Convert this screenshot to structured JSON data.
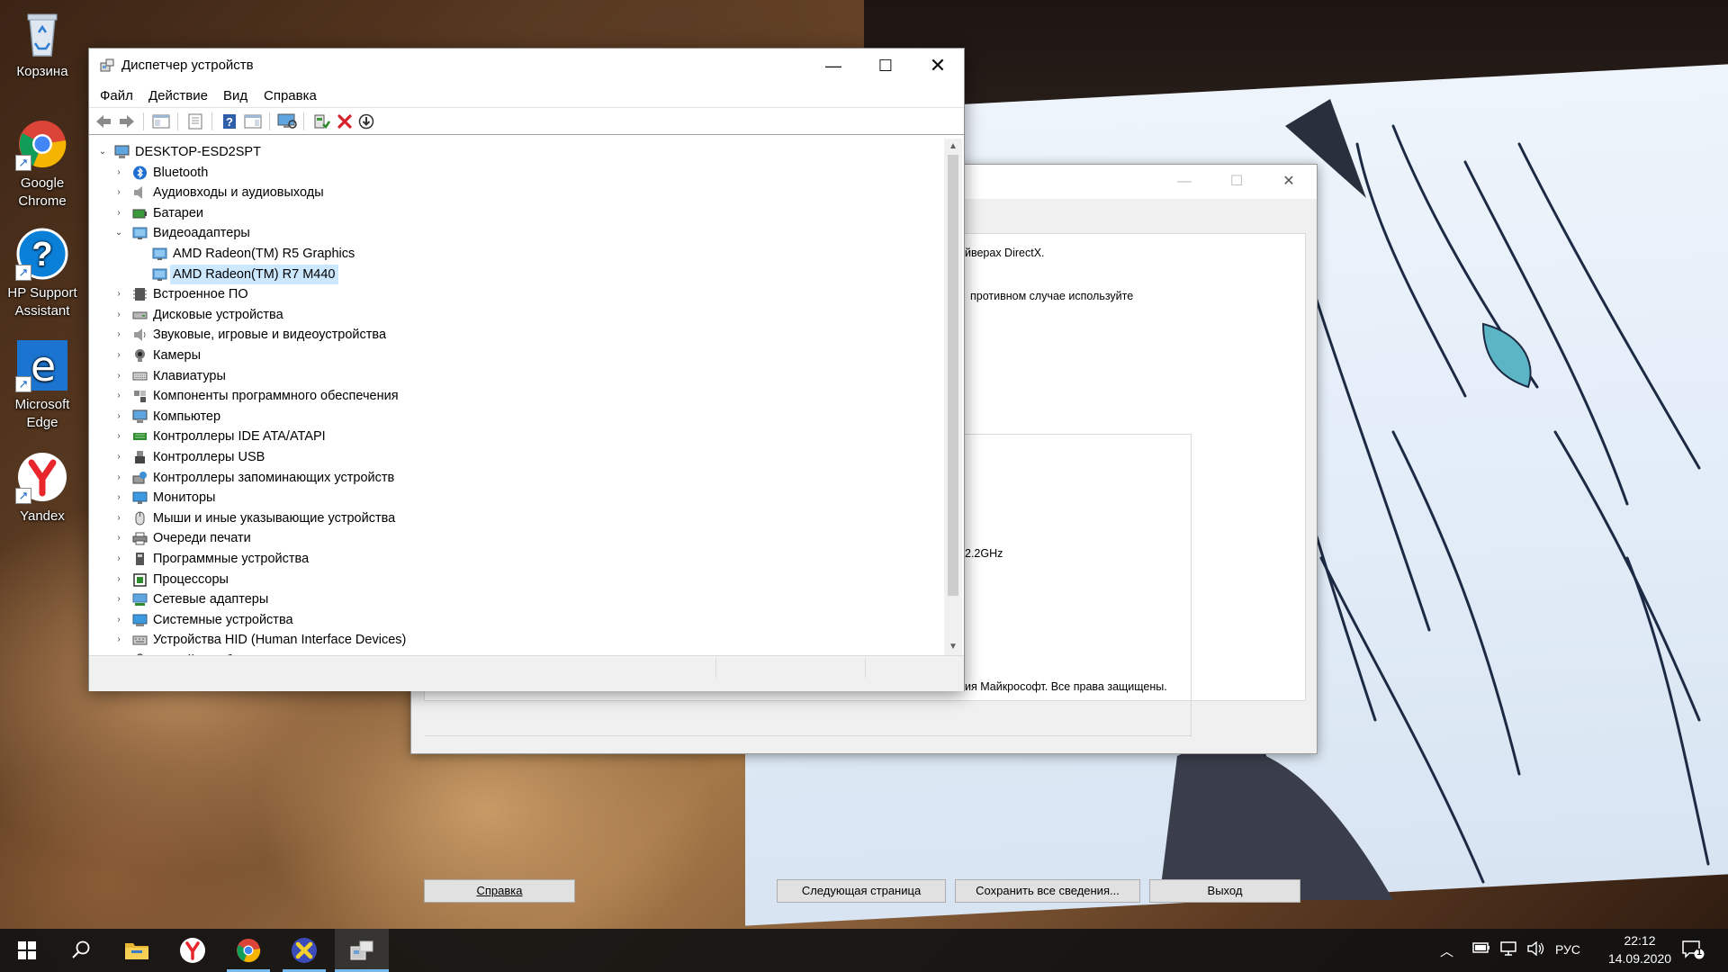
{
  "desktop": {
    "icons": [
      {
        "name": "recycle-bin",
        "label": "Корзина"
      },
      {
        "name": "google-chrome",
        "label": "Google Chrome"
      },
      {
        "name": "hp-support-assistant",
        "label": "HP Support Assistant"
      },
      {
        "name": "microsoft-edge",
        "label": "Microsoft Edge"
      },
      {
        "name": "yandex",
        "label": "Yandex"
      }
    ]
  },
  "dxdiag": {
    "texts": [
      "йверах DirectX.",
      "противном случае используйте",
      "2.2GHz",
      "ия Майкрософт. Все права защищены."
    ],
    "buttons": {
      "help": "Справка",
      "next_page": "Следующая страница",
      "save_all": "Сохранить все сведения...",
      "exit": "Выход"
    }
  },
  "device_manager": {
    "title": "Диспетчер устройств",
    "menu": [
      "Файл",
      "Действие",
      "Вид",
      "Справка"
    ],
    "root": "DESKTOP-ESD2SPT",
    "items": [
      {
        "label": "Bluetooth",
        "icon": "bluetooth-icon",
        "expanded": false
      },
      {
        "label": "Аудиовходы и аудиовыходы",
        "icon": "speaker-icon",
        "expanded": false
      },
      {
        "label": "Батареи",
        "icon": "battery-icon",
        "expanded": false
      },
      {
        "label": "Видеоадаптеры",
        "icon": "display-adapter-icon",
        "expanded": true
      },
      {
        "label": "AMD Radeon(TM) R5 Graphics",
        "icon": "display-adapter-icon",
        "child": true
      },
      {
        "label": "AMD Radeon(TM) R7 M440",
        "icon": "display-adapter-icon",
        "child": true,
        "selected": true
      },
      {
        "label": "Встроенное ПО",
        "icon": "firmware-icon",
        "expanded": false
      },
      {
        "label": "Дисковые устройства",
        "icon": "disk-drive-icon",
        "expanded": false
      },
      {
        "label": "Звуковые, игровые и видеоустройства",
        "icon": "sound-device-icon",
        "expanded": false
      },
      {
        "label": "Камеры",
        "icon": "camera-icon",
        "expanded": false
      },
      {
        "label": "Клавиатуры",
        "icon": "keyboard-icon",
        "expanded": false
      },
      {
        "label": "Компоненты программного обеспечения",
        "icon": "software-component-icon",
        "expanded": false
      },
      {
        "label": "Компьютер",
        "icon": "computer-icon",
        "expanded": false
      },
      {
        "label": "Контроллеры IDE ATA/ATAPI",
        "icon": "ide-controller-icon",
        "expanded": false
      },
      {
        "label": "Контроллеры USB",
        "icon": "usb-icon",
        "expanded": false
      },
      {
        "label": "Контроллеры запоминающих устройств",
        "icon": "storage-controller-icon",
        "expanded": false
      },
      {
        "label": "Мониторы",
        "icon": "monitor-icon",
        "expanded": false
      },
      {
        "label": "Мыши и иные указывающие устройства",
        "icon": "mouse-icon",
        "expanded": false
      },
      {
        "label": "Очереди печати",
        "icon": "printer-icon",
        "expanded": false
      },
      {
        "label": "Программные устройства",
        "icon": "software-device-icon",
        "expanded": false
      },
      {
        "label": "Процессоры",
        "icon": "processor-icon",
        "expanded": false
      },
      {
        "label": "Сетевые адаптеры",
        "icon": "network-adapter-icon",
        "expanded": false
      },
      {
        "label": "Системные устройства",
        "icon": "system-device-icon",
        "expanded": false
      },
      {
        "label": "Устройства HID (Human Interface Devices)",
        "icon": "hid-icon",
        "expanded": false
      },
      {
        "label": "Устройства безопасности",
        "icon": "security-device-icon",
        "expanded": false
      }
    ]
  },
  "taskbar": {
    "apps": [
      {
        "name": "start",
        "icon": "windows-logo-icon"
      },
      {
        "name": "search",
        "icon": "search-icon"
      },
      {
        "name": "file-explorer",
        "icon": "folder-icon"
      },
      {
        "name": "yandex",
        "icon": "yandex-icon"
      },
      {
        "name": "chrome",
        "icon": "chrome-icon",
        "open": true
      },
      {
        "name": "app-x",
        "icon": "x-app-icon",
        "open": true
      },
      {
        "name": "device-manager",
        "icon": "device-manager-icon",
        "active": true
      }
    ],
    "tray": {
      "language": "РУС",
      "time": "22:12",
      "date": "14.09.2020",
      "notifications": "1"
    }
  }
}
